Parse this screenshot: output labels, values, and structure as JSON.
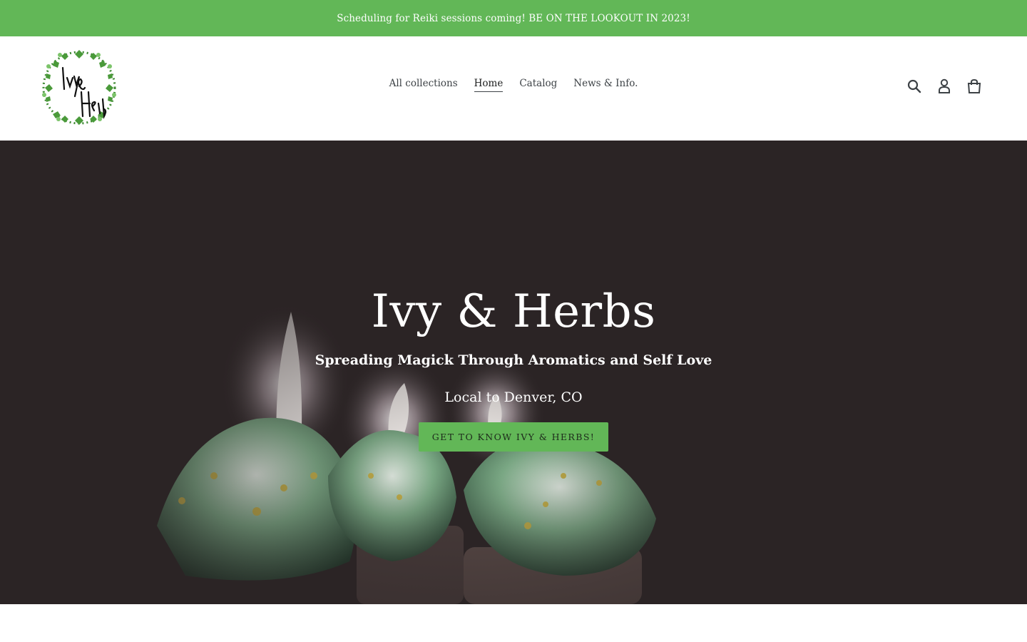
{
  "announcement": {
    "text": "Scheduling for Reiki sessions coming! BE ON THE LOOKOUT IN 2023!"
  },
  "header": {
    "logo_text": "Ivy & Herbs",
    "nav": [
      {
        "label": "All collections"
      },
      {
        "label": "Home",
        "active": true
      },
      {
        "label": "Catalog"
      },
      {
        "label": "News & Info."
      }
    ],
    "icons": [
      "search-icon",
      "account-icon",
      "cart-icon"
    ]
  },
  "hero": {
    "title": "Ivy & Herbs",
    "subtitle": "Spreading Magick Through Aromatics and Self Love",
    "location": "Local to Denver, CO",
    "cta_label": "GET TO KNOW IVY & HERBS!"
  },
  "colors": {
    "accent": "#62b757",
    "hero_bg": "#2b2425",
    "text": "#3d4246"
  }
}
